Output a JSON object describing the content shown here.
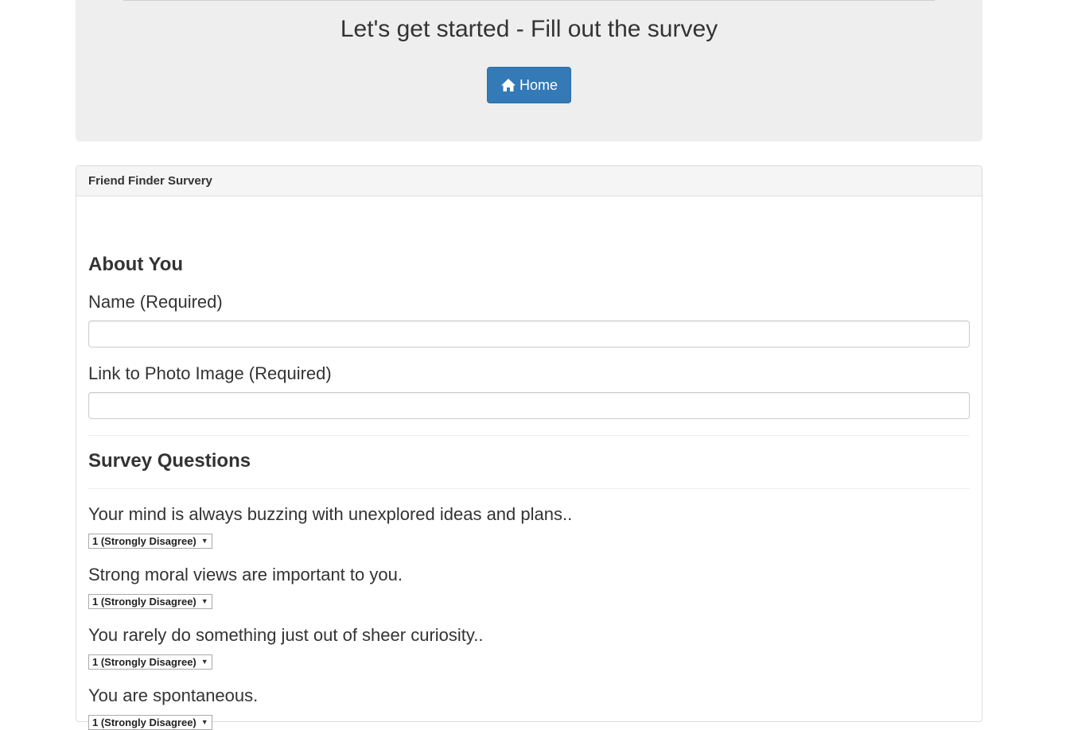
{
  "header": {
    "title": "Let's get started - Fill out the survey",
    "home_label": "Home"
  },
  "panel": {
    "heading": "Friend Finder Survery",
    "about_heading": "About You",
    "name_label": "Name (Required)",
    "name_value": "",
    "photo_label": "Link to Photo Image (Required)",
    "photo_value": "",
    "survey_heading": "Survey Questions",
    "questions": [
      {
        "text": "Your mind is always buzzing with unexplored ideas and plans..",
        "selected": "1 (Strongly Disagree)"
      },
      {
        "text": "Strong moral views are important to you.",
        "selected": "1 (Strongly Disagree)"
      },
      {
        "text": "You rarely do something just out of sheer curiosity..",
        "selected": "1 (Strongly Disagree)"
      },
      {
        "text": "You are spontaneous.",
        "selected": "1 (Strongly Disagree)"
      }
    ]
  },
  "icons": {
    "home": "home-icon",
    "dropdown": "chevron-down-icon"
  },
  "colors": {
    "primary_button": "#337ab7",
    "jumbotron_bg": "#eeeeee",
    "panel_heading_bg": "#f5f5f5"
  }
}
